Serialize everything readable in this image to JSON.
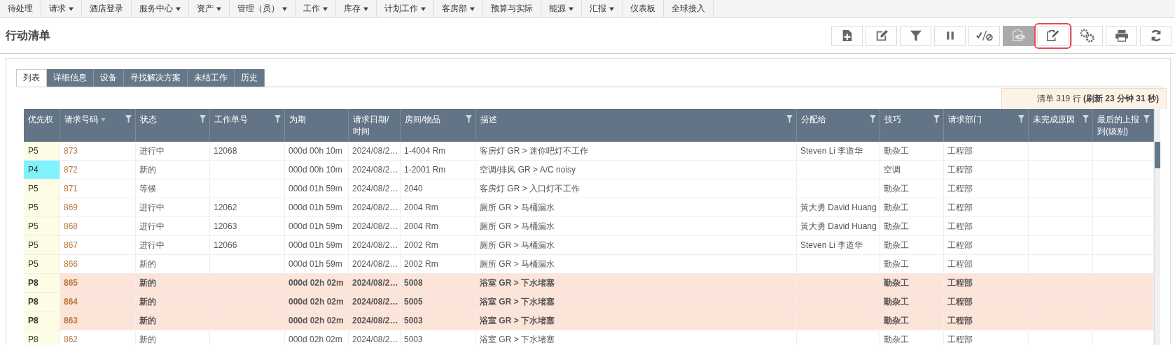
{
  "menu": [
    {
      "label": "待处理",
      "dropdown": false
    },
    {
      "label": "请求",
      "dropdown": true
    },
    {
      "label": "酒店登录",
      "dropdown": false
    },
    {
      "label": "服务中心",
      "dropdown": true
    },
    {
      "label": "资产",
      "dropdown": true
    },
    {
      "label": "管理（员）",
      "dropdown": true
    },
    {
      "label": "工作",
      "dropdown": true
    },
    {
      "label": "库存",
      "dropdown": true
    },
    {
      "label": "计划工作",
      "dropdown": true
    },
    {
      "label": "客房部",
      "dropdown": true
    },
    {
      "label": "预算与实际",
      "dropdown": false
    },
    {
      "label": "能源",
      "dropdown": true
    },
    {
      "label": "汇报",
      "dropdown": true
    },
    {
      "label": "仪表板",
      "dropdown": false
    },
    {
      "label": "全球接入",
      "dropdown": false
    }
  ],
  "page_title": "行动清单",
  "toolbar": [
    {
      "kind": "new",
      "disabled": false,
      "highlighted": false
    },
    {
      "kind": "edit",
      "disabled": false,
      "highlighted": false
    },
    {
      "kind": "filter",
      "disabled": false,
      "highlighted": false
    },
    {
      "kind": "pause",
      "disabled": false,
      "highlighted": false
    },
    {
      "kind": "approve",
      "disabled": false,
      "highlighted": false
    },
    {
      "kind": "preview",
      "disabled": true,
      "highlighted": false
    },
    {
      "kind": "notes",
      "disabled": false,
      "highlighted": true
    },
    {
      "kind": "settings",
      "disabled": false,
      "highlighted": false
    },
    {
      "kind": "print",
      "disabled": false,
      "highlighted": false
    },
    {
      "kind": "refresh",
      "disabled": false,
      "highlighted": false
    }
  ],
  "tabs": [
    {
      "label": "列表",
      "selected": true
    },
    {
      "label": "详细信息",
      "selected": false
    },
    {
      "label": "设备",
      "selected": false
    },
    {
      "label": "寻找解决方案",
      "selected": false
    },
    {
      "label": "未结工作",
      "selected": false
    },
    {
      "label": "历史",
      "selected": false
    }
  ],
  "summary": "清单 319 行 **(刷新 23 分钟 31 秒)**",
  "table": {
    "columns": [
      {
        "label": "优先权",
        "filter": false,
        "sorted": false
      },
      {
        "label": "请求号码",
        "filter": true,
        "sorted": true
      },
      {
        "label": "状态",
        "filter": true,
        "sorted": false
      },
      {
        "label": "工作单号",
        "filter": true,
        "sorted": false
      },
      {
        "label": "为期",
        "filter": false,
        "sorted": false
      },
      {
        "label": "请求日期/时间",
        "filter": false,
        "sorted": false
      },
      {
        "label": "房间/物品",
        "filter": true,
        "sorted": false
      },
      {
        "label": "描述",
        "filter": true,
        "sorted": false
      },
      {
        "label": "分配给",
        "filter": true,
        "sorted": false
      },
      {
        "label": "技巧",
        "filter": true,
        "sorted": false
      },
      {
        "label": "请求部门",
        "filter": true,
        "sorted": false
      },
      {
        "label": "未完成原因",
        "filter": true,
        "sorted": false
      },
      {
        "label": "最后的上报到(级别)",
        "filter": true,
        "sorted": false
      }
    ],
    "rows": [
      {
        "priority": "P5",
        "color": "#fdfde6",
        "highlighted": false,
        "number": "873",
        "status": "进行中",
        "work_order": "12068",
        "duration": "000d 00h 10m",
        "date": "2024/08/2…",
        "room": "1-4004 Rm",
        "description": "客房灯 GR > 迷你吧灯不工作",
        "assigned_to": "Steven Li 李道华",
        "skill": "勤杂工",
        "department": "工程部"
      },
      {
        "priority": "P4",
        "color": "#7ef3fc",
        "highlighted": false,
        "number": "872",
        "status": "新的",
        "duration": "000d 00h 10m",
        "date": "2024/08/2…",
        "room": "1-2001 Rm",
        "description": "空调/排风 GR > A/C noisy",
        "skill": "空调",
        "department": "工程部"
      },
      {
        "priority": "P5",
        "color": "#fdfde6",
        "highlighted": false,
        "number": "871",
        "status": "等候",
        "duration": "000d 01h 59m",
        "date": "2024/08/2…",
        "room": "2040",
        "description": "客房灯 GR > 入口灯不工作",
        "skill": "勤杂工",
        "department": "工程部"
      },
      {
        "priority": "P5",
        "color": "#fdfde6",
        "highlighted": false,
        "number": "869",
        "status": "进行中",
        "work_order": "12062",
        "duration": "000d 01h 59m",
        "date": "2024/08/2…",
        "room": "2004 Rm",
        "description": "厕所 GR > 马桶漏水",
        "assigned_to": "黃大勇 David Huang",
        "skill": "勤杂工",
        "department": "工程部"
      },
      {
        "priority": "P5",
        "color": "#fdfde6",
        "highlighted": false,
        "number": "868",
        "status": "进行中",
        "work_order": "12063",
        "duration": "000d 01h 59m",
        "date": "2024/08/2…",
        "room": "2004 Rm",
        "description": "厕所 GR > 马桶漏水",
        "assigned_to": "黃大勇 David Huang",
        "skill": "勤杂工",
        "department": "工程部"
      },
      {
        "priority": "P5",
        "color": "#fdfde6",
        "highlighted": false,
        "number": "867",
        "status": "进行中",
        "work_order": "12066",
        "duration": "000d 01h 59m",
        "date": "2024/08/2…",
        "room": "2002 Rm",
        "description": "厕所 GR > 马桶漏水",
        "assigned_to": "Steven Li 李道华",
        "skill": "勤杂工",
        "department": "工程部"
      },
      {
        "priority": "P5",
        "color": "#fdfde6",
        "highlighted": false,
        "number": "866",
        "status": "新的",
        "duration": "000d 01h 59m",
        "date": "2024/08/2…",
        "room": "2002 Rm",
        "description": "厕所 GR > 马桶漏水",
        "skill": "勤杂工",
        "department": "工程部"
      },
      {
        "priority": "P8",
        "color": "#fdfde6",
        "highlighted": true,
        "number": "865",
        "status": "新的",
        "duration": "000d 02h 02m",
        "date": "2024/08/2…",
        "room": "5008",
        "description": "浴室 GR > 下水堵塞",
        "skill": "勤杂工",
        "department": "工程部"
      },
      {
        "priority": "P8",
        "color": "#fdfde6",
        "highlighted": true,
        "number": "864",
        "status": "新的",
        "duration": "000d 02h 02m",
        "date": "2024/08/2…",
        "room": "5005",
        "description": "浴室 GR > 下水堵塞",
        "skill": "勤杂工",
        "department": "工程部"
      },
      {
        "priority": "P8",
        "color": "#fdfde6",
        "highlighted": true,
        "number": "863",
        "status": "新的",
        "duration": "000d 02h 02m",
        "date": "2024/08/2…",
        "room": "5003",
        "description": "浴室 GR > 下水堵塞",
        "skill": "勤杂工",
        "department": "工程部"
      },
      {
        "priority": "P8",
        "color": "#fdfde6",
        "highlighted": false,
        "number": "862",
        "status": "新的",
        "duration": "000d 02h 02m",
        "date": "2024/08/2…",
        "room": "5003",
        "description": "浴室 GR > 下水堵塞",
        "skill": "勤杂工",
        "department": "工程部"
      }
    ]
  }
}
